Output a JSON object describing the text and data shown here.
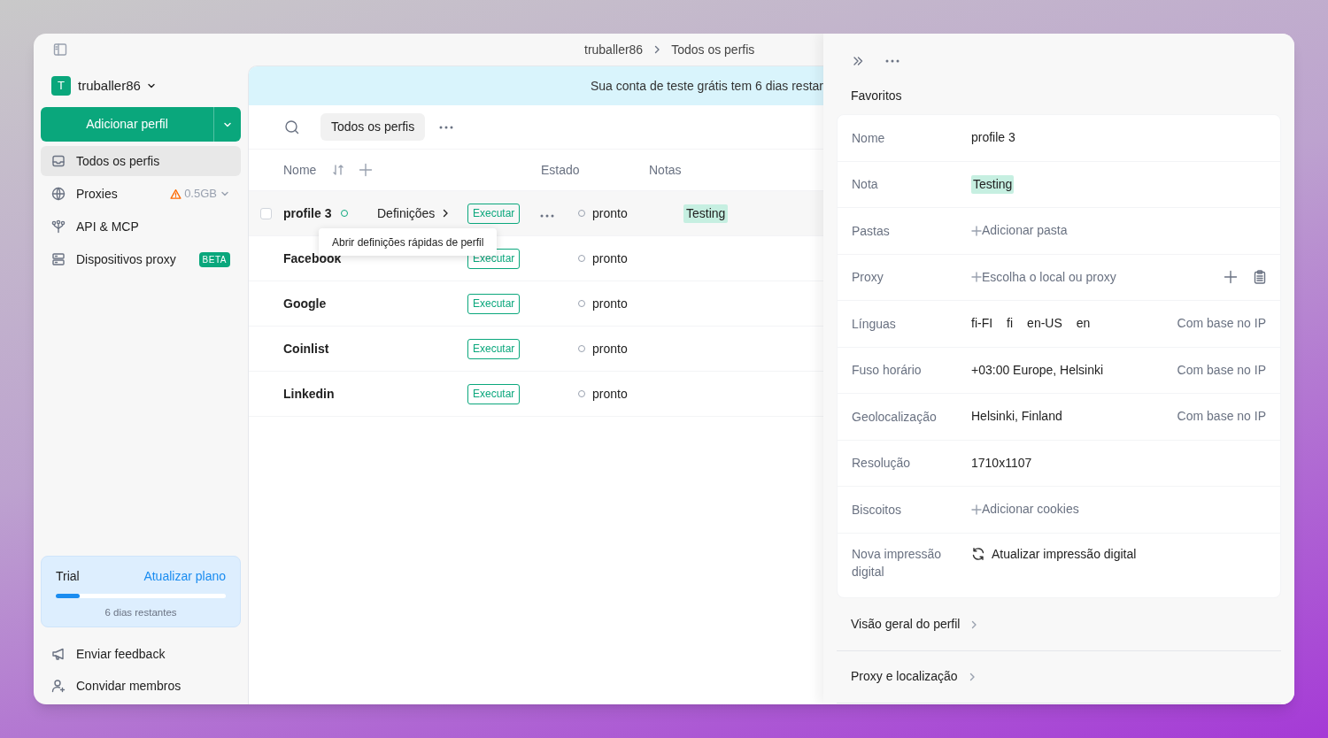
{
  "sidebar": {
    "account": {
      "initial": "T",
      "name": "truballer86"
    },
    "add_button": "Adicionar perfil",
    "nav": [
      {
        "kind": "profiles",
        "label": "Todos os perfis",
        "selected": true
      },
      {
        "kind": "proxies",
        "label": "Proxies",
        "usage": "0.5GB",
        "selected": false
      },
      {
        "kind": "api",
        "label": "API & MCP",
        "selected": false
      },
      {
        "kind": "devices",
        "label": "Dispositivos proxy",
        "badge": "BETA",
        "selected": false
      }
    ],
    "trial": {
      "label": "Trial",
      "link": "Atualizar plano",
      "level": 0.14,
      "remaining": "6 dias restantes"
    },
    "footer": [
      {
        "kind": "feedback",
        "label": "Enviar feedback"
      },
      {
        "kind": "invite",
        "label": "Convidar membros"
      }
    ]
  },
  "breadcrumb": [
    "truballer86",
    "Todos os perfis"
  ],
  "banner": "Sua conta de teste grátis tem 6 dias restar",
  "toolbar": {
    "filter": "Todos os perfis"
  },
  "table": {
    "columns": {
      "name": "Nome",
      "status": "Estado",
      "notes": "Notas"
    },
    "rows": [
      {
        "name": "profile 3",
        "settings": "Definições",
        "run": "Executar",
        "status": "pronto",
        "note": "Testing",
        "highlighted": true
      },
      {
        "name": "Facebook",
        "run": "Executar",
        "status": "pronto",
        "highlighted": false
      },
      {
        "name": "Google",
        "run": "Executar",
        "status": "pronto",
        "highlighted": false
      },
      {
        "name": "Coinlist",
        "run": "Executar",
        "status": "pronto",
        "highlighted": false
      },
      {
        "name": "Linkedin",
        "run": "Executar",
        "status": "pronto",
        "highlighted": false
      }
    ]
  },
  "tooltip": "Abrir definições rápidas de perfil",
  "panel": {
    "section": "Favoritos",
    "fields": [
      {
        "kind": "text",
        "label": "Nome",
        "value": "profile 3"
      },
      {
        "kind": "tag",
        "label": "Nota",
        "value": "Testing"
      },
      {
        "kind": "add",
        "label": "Pastas",
        "value": "Adicionar pasta"
      },
      {
        "kind": "add",
        "label": "Proxy",
        "value": "Escolha o local ou proxy",
        "actions": true
      },
      {
        "kind": "chips",
        "label": "Línguas",
        "values": [
          "fi-FI",
          "fi",
          "en-US",
          "en"
        ],
        "source": "Com base no IP"
      },
      {
        "kind": "text",
        "label": "Fuso horário",
        "value": "+03:00 Europe, Helsinki",
        "source": "Com base no IP"
      },
      {
        "kind": "text",
        "label": "Geolocalização",
        "value": "Helsinki, Finland",
        "source": "Com base no IP"
      },
      {
        "kind": "text",
        "label": "Resolução",
        "value": "1710x1107"
      },
      {
        "kind": "add",
        "label": "Biscoitos",
        "value": "Adicionar cookies"
      },
      {
        "kind": "action",
        "label": "Nova impressão digital",
        "value": "Atualizar impressão digital"
      }
    ],
    "links": [
      "Visão geral do perfil",
      "Proxy e localização"
    ]
  }
}
